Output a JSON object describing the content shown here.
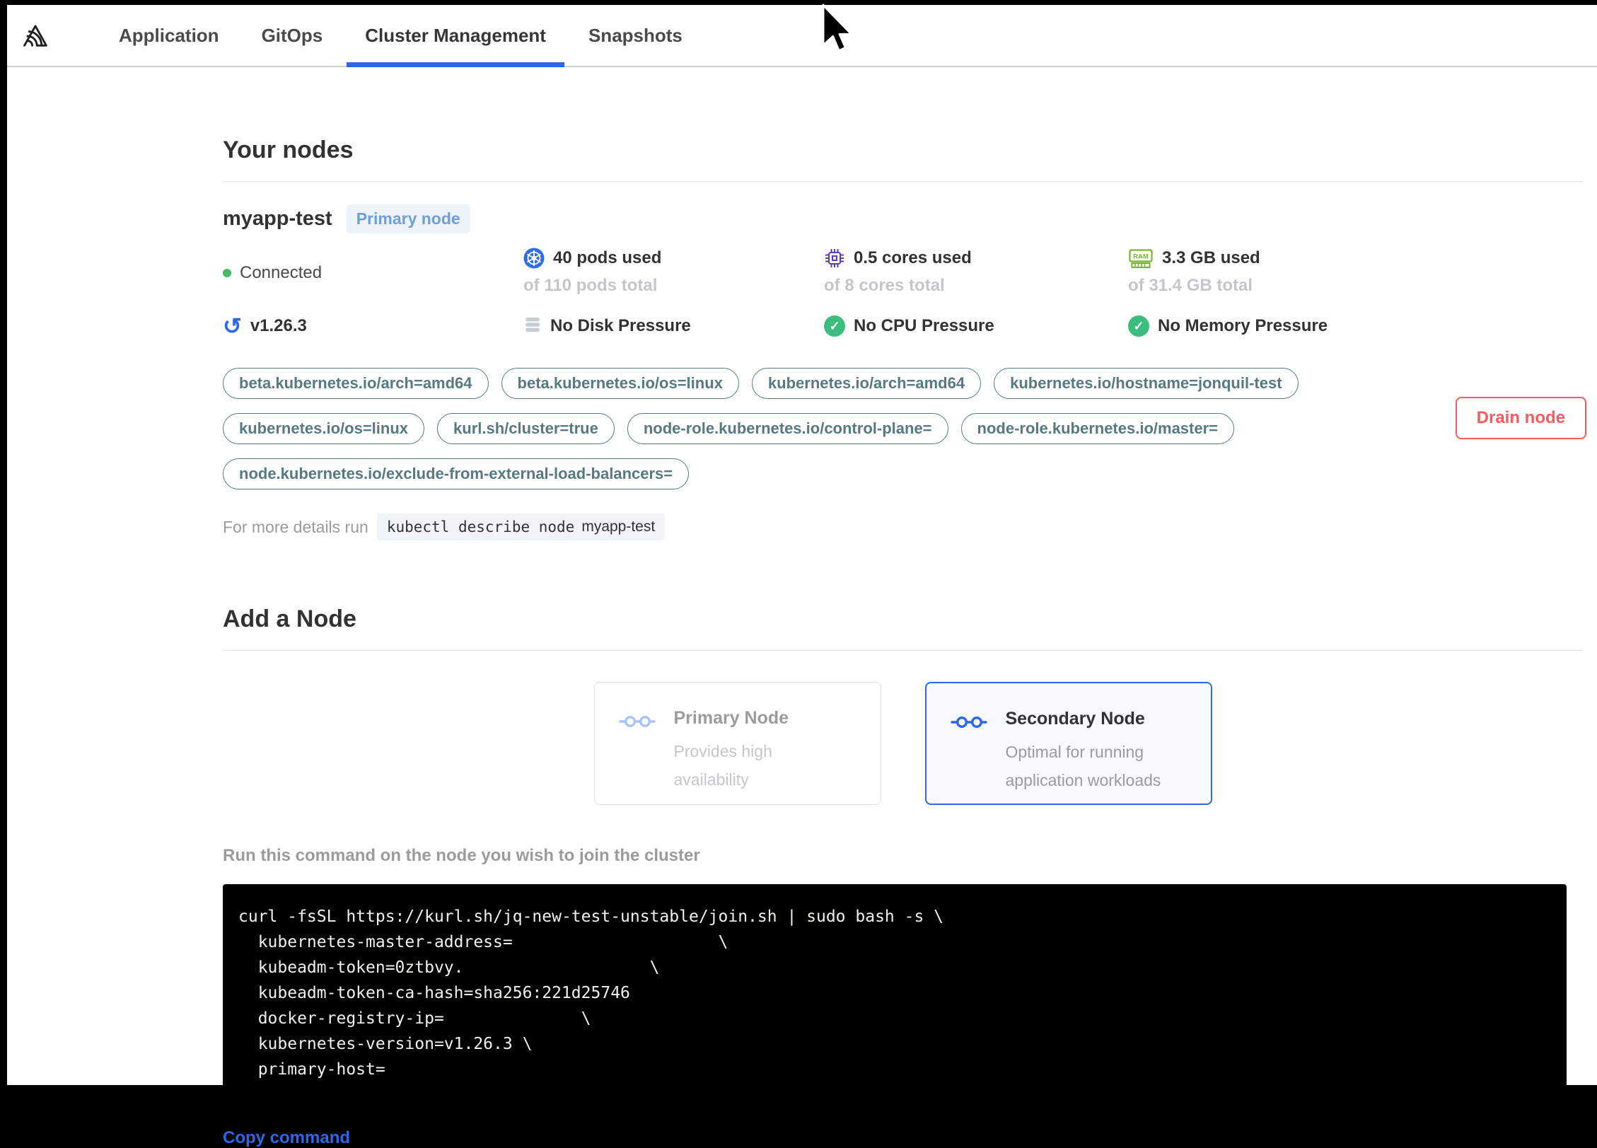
{
  "nav": {
    "logo": "kurl-logo",
    "tabs": [
      {
        "label": "Application",
        "active": false
      },
      {
        "label": "GitOps",
        "active": false
      },
      {
        "label": "Cluster Management",
        "active": true
      },
      {
        "label": "Snapshots",
        "active": false
      }
    ]
  },
  "your_nodes": {
    "heading": "Your nodes",
    "node": {
      "name": "myapp-test",
      "badge": "Primary node",
      "status": "Connected",
      "stats": [
        {
          "icon": "kubernetes-pods-icon",
          "used": "40 pods used",
          "total": "of 110 pods total"
        },
        {
          "icon": "cpu-icon",
          "used": "0.5 cores used",
          "total": "of 8 cores total"
        },
        {
          "icon": "ram-icon",
          "used": "3.3 GB used",
          "total": "of 31.4 GB total"
        }
      ],
      "conditions": [
        {
          "icon": "version-icon",
          "label": "v1.26.3"
        },
        {
          "icon": "disk-icon",
          "label": "No Disk Pressure"
        },
        {
          "icon": "check-icon",
          "label": "No CPU Pressure"
        },
        {
          "icon": "check-icon",
          "label": "No Memory Pressure"
        }
      ],
      "labels": [
        "beta.kubernetes.io/arch=amd64",
        "beta.kubernetes.io/os=linux",
        "kubernetes.io/arch=amd64",
        "kubernetes.io/hostname=jonquil-test",
        "kubernetes.io/os=linux",
        "kurl.sh/cluster=true",
        "node-role.kubernetes.io/control-plane=",
        "node-role.kubernetes.io/master=",
        "node.kubernetes.io/exclude-from-external-load-balancers="
      ],
      "details_prefix": "For more details run",
      "details_command": "kubectl describe node",
      "details_node": "myapp-test",
      "drain_button": "Drain node"
    }
  },
  "add_node": {
    "heading": "Add a Node",
    "options": [
      {
        "title": "Primary Node",
        "description": "Provides high availability",
        "state": "disabled"
      },
      {
        "title": "Secondary Node",
        "description": "Optimal for running application workloads",
        "state": "selected"
      }
    ],
    "instruction": "Run this command on the node you wish to join the cluster",
    "command_lines": [
      "curl -fsSL https://kurl.sh/jq-new-test-unstable/join.sh | sudo bash -s \\",
      "  kubernetes-master-address=                     \\",
      "  kubeadm-token=0ztbvy.                   \\",
      "  kubeadm-token-ca-hash=sha256:221d25746",
      "  docker-registry-ip=              \\",
      "  kubernetes-version=v1.26.3 \\",
      "  primary-host="
    ],
    "copy_label": "Copy command"
  },
  "colors": {
    "accent_blue": "#2b67e8",
    "kubernetes_blue": "#326de6",
    "danger_red": "#f65c5c",
    "status_green": "#44bb66",
    "check_green": "#3dbd7d",
    "tag_teal": "#577981",
    "cpu_purple": "#5b3dbe",
    "ram_green": "#77b62e",
    "muted_gray": "#c3c7ca",
    "text_gray": "#9b9b9b",
    "text_dark": "#323232"
  }
}
